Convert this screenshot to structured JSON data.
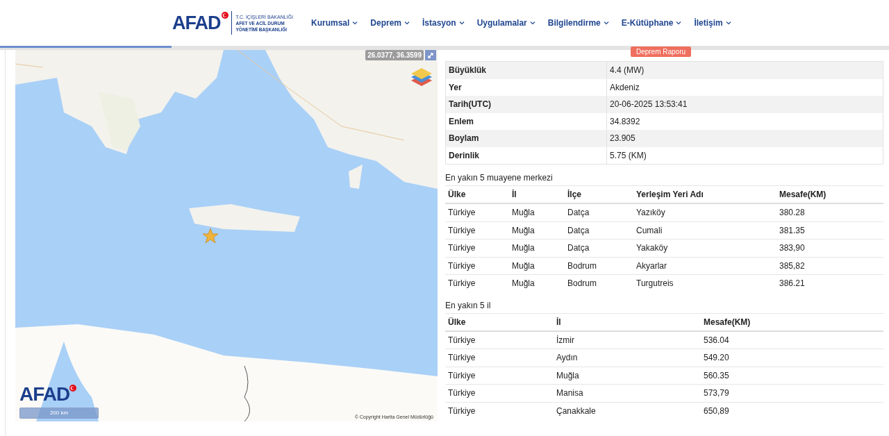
{
  "header": {
    "logo": "AFAD",
    "ministry": "T.C. İÇİŞLERİ BAKANLIĞI",
    "agency_line_1": "AFET VE ACİL DURUM",
    "agency_line_2": "YÖNETİMİ BAŞKANLIĞI",
    "nav": [
      {
        "label": "Kurumsal"
      },
      {
        "label": "Deprem"
      },
      {
        "label": "İstasyon"
      },
      {
        "label": "Uygulamalar"
      },
      {
        "label": "Bilgilendirme"
      },
      {
        "label": "E-Kütüphane"
      },
      {
        "label": "İletişim"
      }
    ]
  },
  "map": {
    "coordinates": "26.0377, 36.3599",
    "logo": "AFAD",
    "scale": "200 km",
    "copyright": "© Copyright Harita Genel Müdürlüğü"
  },
  "report_button": "Deprem Raporu",
  "details": [
    {
      "label": "Büyüklük",
      "value": "4.4 (MW)"
    },
    {
      "label": "Yer",
      "value": "Akdeniz"
    },
    {
      "label": "Tarih(UTC)",
      "value": "20-06-2025 13:53:41"
    },
    {
      "label": "Enlem",
      "value": "34.8392"
    },
    {
      "label": "Boylam",
      "value": "23.905"
    },
    {
      "label": "Derinlik",
      "value": "5.75 (KM)"
    }
  ],
  "stations": {
    "title": "En yakın 5 muayene merkezi",
    "columns": [
      "Ülke",
      "İl",
      "İlçe",
      "Yerleşim Yeri Adı",
      "Mesafe(KM)"
    ],
    "rows": [
      [
        "Türkiye",
        "Muğla",
        "Datça",
        "Yazıköy",
        "380.28"
      ],
      [
        "Türkiye",
        "Muğla",
        "Datça",
        "Cumali",
        "381.35"
      ],
      [
        "Türkiye",
        "Muğla",
        "Datça",
        "Yakaköy",
        "383,90"
      ],
      [
        "Türkiye",
        "Muğla",
        "Bodrum",
        "Akyarlar",
        "385,82"
      ],
      [
        "Türkiye",
        "Muğla",
        "Bodrum",
        "Turgutreis",
        "386.21"
      ]
    ]
  },
  "provinces": {
    "title": "En yakın 5 il",
    "columns": [
      "Ülke",
      "İl",
      "Mesafe(KM)"
    ],
    "rows": [
      [
        "Türkiye",
        "İzmir",
        "536.04"
      ],
      [
        "Türkiye",
        "Aydın",
        "549.20"
      ],
      [
        "Türkiye",
        "Muğla",
        "560.35"
      ],
      [
        "Türkiye",
        "Manisa",
        "573,79"
      ],
      [
        "Türkiye",
        "Çanakkale",
        "650,89"
      ]
    ]
  }
}
